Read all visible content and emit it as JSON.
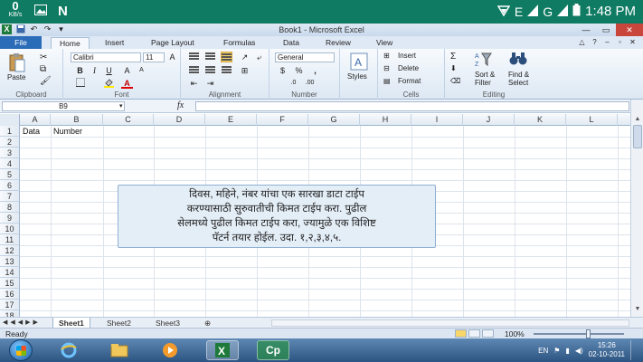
{
  "status_bar": {
    "net_speed_value": "0",
    "net_speed_unit": "KB/s",
    "network_type": "E",
    "network_type_2": "G",
    "time": "1:48 PM"
  },
  "window": {
    "title": "Book1 - Microsoft Excel"
  },
  "ribbon_tabs": [
    "File",
    "Home",
    "Insert",
    "Page Layout",
    "Formulas",
    "Data",
    "Review",
    "View"
  ],
  "ribbon": {
    "paste_label": "Paste",
    "clipboard_label": "Clipboard",
    "font_name": "Calibri",
    "font_size": "11",
    "font_label": "Font",
    "alignment_label": "Alignment",
    "number_format": "General",
    "number_label": "Number",
    "styles_label": "Styles",
    "insert_label": "Insert",
    "delete_label": "Delete",
    "format_label": "Format",
    "cells_label": "Cells",
    "sort_filter_label_1": "Sort &",
    "sort_filter_label_2": "Filter",
    "find_select_label_1": "Find &",
    "find_select_label_2": "Select",
    "editing_label": "Editing"
  },
  "formula_bar": {
    "name_box": "B9",
    "fx": "fx",
    "formula": ""
  },
  "grid": {
    "columns": [
      "A",
      "B",
      "C",
      "D",
      "E",
      "F",
      "G",
      "H",
      "I",
      "J",
      "K",
      "L"
    ],
    "rows": [
      "1",
      "2",
      "3",
      "4",
      "5",
      "6",
      "7",
      "8",
      "9",
      "10",
      "11",
      "12",
      "13",
      "14",
      "15",
      "16",
      "17",
      "18"
    ],
    "cells": {
      "A1": "Data",
      "B1": "Number"
    }
  },
  "callout": {
    "lines": [
      "दिवस, महिने, नंबर यांचा एक सारखा डाटा टाईप",
      "करण्यासाठी सुरुवातीची किमत टाईप करा. पुढील",
      "सेलमध्ये पुढील किमत टाईप करा, ज्यामुळे एक विशिष्ट",
      "पॅटर्न तयार होईल. उदा. १,२,३,४,५."
    ]
  },
  "sheet_tabs": [
    "Sheet1",
    "Sheet2",
    "Sheet3"
  ],
  "excel_status": {
    "ready": "Ready",
    "zoom": "100%"
  },
  "taskbar": {
    "cp_label": "Cp",
    "language": "EN",
    "clock_time": "15:26",
    "clock_date": "02-10-2011"
  }
}
